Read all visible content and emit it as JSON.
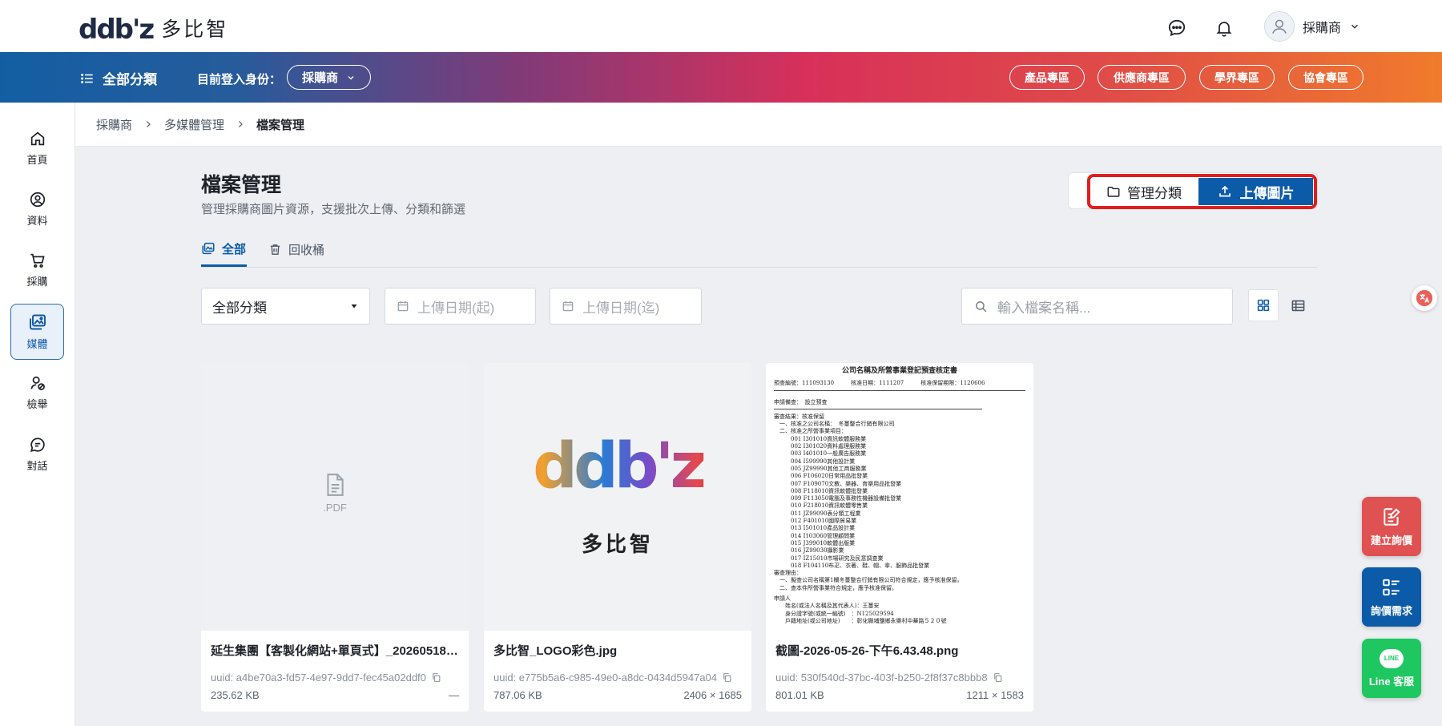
{
  "header": {
    "logo_mark": "ddb'z",
    "logo_text": "多比智",
    "user_name": "採購商"
  },
  "banner": {
    "all_categories": "全部分類",
    "role_label": "目前登入身份：",
    "role_value": "採購商",
    "zones": [
      "產品專區",
      "供應商專區",
      "學界專區",
      "協會專區"
    ]
  },
  "sidebar": {
    "items": [
      {
        "label": "首頁",
        "icon": "home-icon"
      },
      {
        "label": "資料",
        "icon": "user-circle-icon"
      },
      {
        "label": "採購",
        "icon": "cart-icon"
      },
      {
        "label": "媒體",
        "icon": "media-icon"
      },
      {
        "label": "檢舉",
        "icon": "report-icon"
      },
      {
        "label": "對話",
        "icon": "chat-icon"
      }
    ]
  },
  "breadcrumb": [
    "採購商",
    "多媒體管理",
    "檔案管理"
  ],
  "page": {
    "title": "檔案管理",
    "subtitle": "管理採購商圖片資源，支援批次上傳、分類和篩選",
    "manage_categories": "管理分類",
    "upload_images": "上傳圖片"
  },
  "tabs": [
    "全部",
    "回收桶"
  ],
  "filters": {
    "category": "全部分類",
    "date_from_placeholder": "上傳日期(起)",
    "date_to_placeholder": "上傳日期(迄)",
    "search_placeholder": "輸入檔案名稱..."
  },
  "files": [
    {
      "thumb_label": ".PDF",
      "name": "延生集團【客製化網站+單頁式】_20260518…",
      "uuid": "uuid: a4be70a3-fd57-4e97-9dd7-fec45a02ddf0",
      "size": "235.62 KB",
      "dims": "—"
    },
    {
      "logo_mark": "ddb'z",
      "logo_text": "多比智",
      "name": "多比智_LOGO彩色.jpg",
      "uuid": "uuid: e775b5a6-c985-49e0-a8dc-0434d5947a04",
      "size": "787.06 KB",
      "dims": "2406 × 1685"
    },
    {
      "name": "截圖-2026-05-26-下午6.43.48.png",
      "uuid": "uuid: 530f540d-37bc-403f-b250-2f8f37c8bbb8",
      "size": "801.01 KB",
      "dims": "1211 × 1583"
    }
  ],
  "document_preview": {
    "title": "公司名稱及所營事業登記預查核定書",
    "lines": [
      "預查編號：111093130　　　核准日期：1111207　　　核准保留期限：1120606",
      "申請備查：　設立預查",
      "審查結果：核准保留",
      "　一、核准之公司名稱：　冬蔓整合行銷有限公司",
      "　二、核准之所營事業項目：",
      "　　　001 I301010資訊軟體服務業",
      "　　　002 I301020資料處理服務業",
      "　　　003 I401010一般廣告服務業",
      "　　　004 I599990其他設計業",
      "　　　005 JZ99990其他工商服務業",
      "　　　006 F106020日常用品批發業",
      "　　　007 F109070文教、樂器、育樂用品批發業",
      "　　　008 F118010資訊軟體批發業",
      "　　　009 F113050電腦及事務性機器設備批發業",
      "　　　010 F218010資訊軟體零售業",
      "　　　011 JZ99090表分類工程業",
      "　　　012 F401010國際貿易業",
      "　　　013 I501010產品設計業",
      "　　　014 I103060管理顧問業",
      "　　　015 J399010軟體出版業",
      "　　　016 JZ99030攝影業",
      "　　　017 IZ15010市場研究及民意調查業",
      "　　　018 F104110布疋、衣著、鞋、帽、傘、服飾品批發業",
      "審查理由：",
      "　一、擬查公司名稱第1欄冬蔓整合行銷有限公司符合規定，應予核准保留。",
      "　二、查本件所營事業符合規定，應予核准保留。",
      "申請人",
      "　　姓名(或法人名稱及其代表人)：王蔓安",
      "　　身分證字號(或統一編號)　：N125029594",
      "　　戶籍地址(或公司地址)　　：彰化縣埔鹽鄉永樂村中華路５２０號"
    ]
  },
  "float_buttons": [
    {
      "label": "建立詢價",
      "color": "#e05252"
    },
    {
      "label": "詢價需求",
      "color": "#0b5ba8"
    },
    {
      "label": "Line 客服",
      "color": "#1ec760",
      "badge": "LINE"
    }
  ],
  "colors": {
    "primary": "#0b5ba8",
    "highlight": "#e01e1e",
    "background": "#edeff3"
  }
}
